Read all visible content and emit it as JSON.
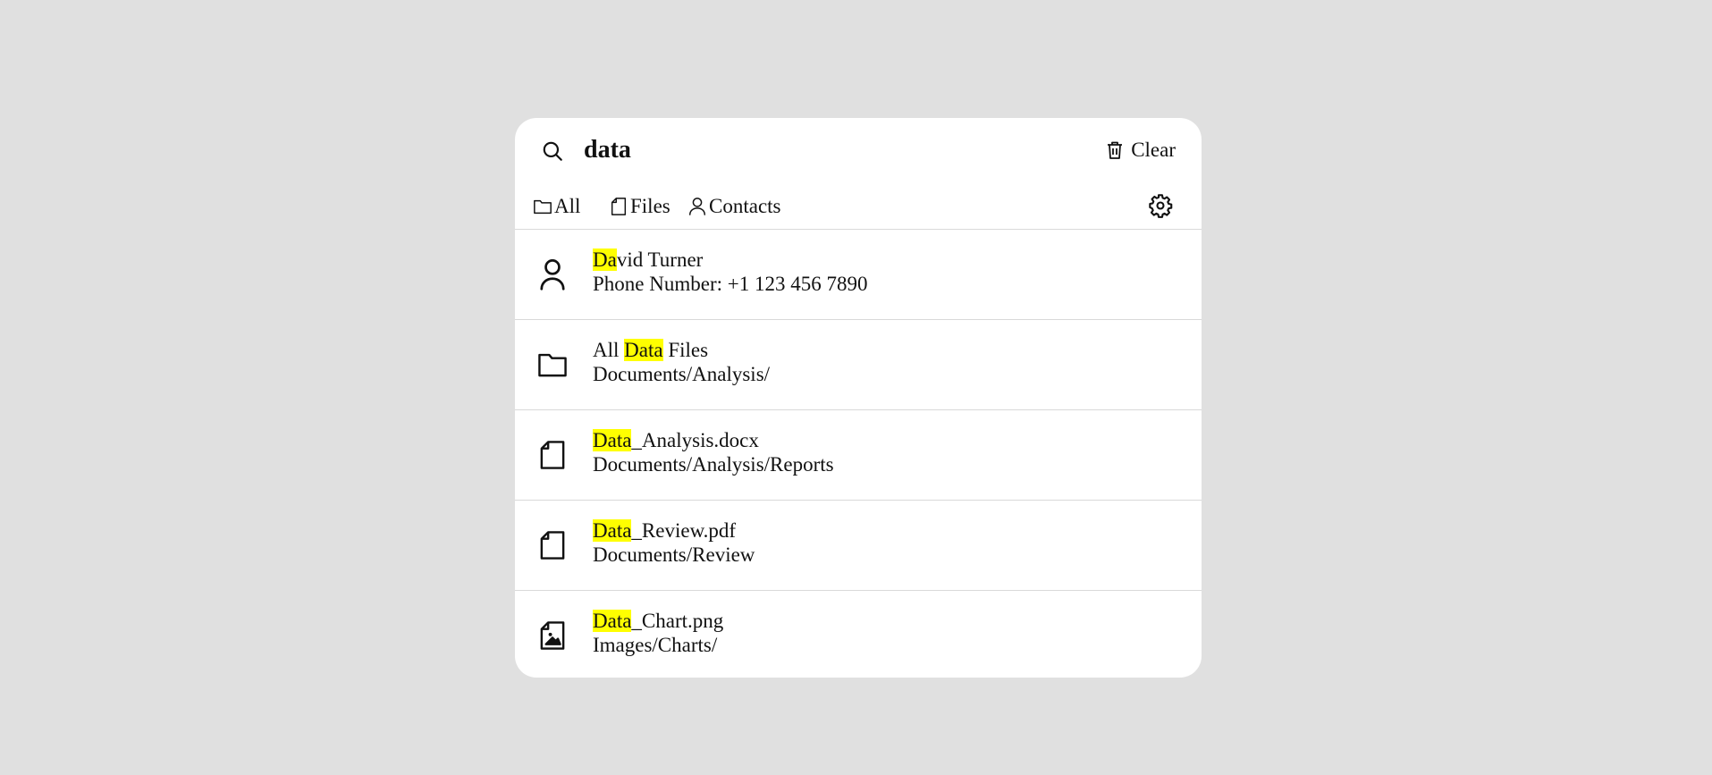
{
  "search": {
    "query": "data",
    "clear_label": "Clear"
  },
  "tabs": [
    {
      "label": "All",
      "icon": "folder-icon"
    },
    {
      "label": "Files",
      "icon": "file-icon"
    },
    {
      "label": "Contacts",
      "icon": "person-icon"
    }
  ],
  "settings": {
    "icon": "gear-icon"
  },
  "colors": {
    "highlight": "#ffff00",
    "background": "#e0e0e0",
    "panel": "#ffffff",
    "divider": "#d9d9d9"
  },
  "results": [
    {
      "icon": "person-icon",
      "title_pre": "",
      "title_hl": "Da",
      "title_post": "vid Turner",
      "subtitle": "Phone Number: +1 123 456 7890"
    },
    {
      "icon": "folder-icon",
      "title_pre": "All ",
      "title_hl": "Data",
      "title_post": " Files",
      "subtitle": "Documents/Analysis/"
    },
    {
      "icon": "file-icon",
      "title_pre": "",
      "title_hl": "Data",
      "title_post": "_Analysis.docx",
      "subtitle": "Documents/Analysis/Reports"
    },
    {
      "icon": "file-icon",
      "title_pre": "",
      "title_hl": "Data",
      "title_post": "_Review.pdf",
      "subtitle": "Documents/Review"
    },
    {
      "icon": "image-file-icon",
      "title_pre": "",
      "title_hl": "Data",
      "title_post": "_Chart.png",
      "subtitle": "Images/Charts/"
    }
  ]
}
